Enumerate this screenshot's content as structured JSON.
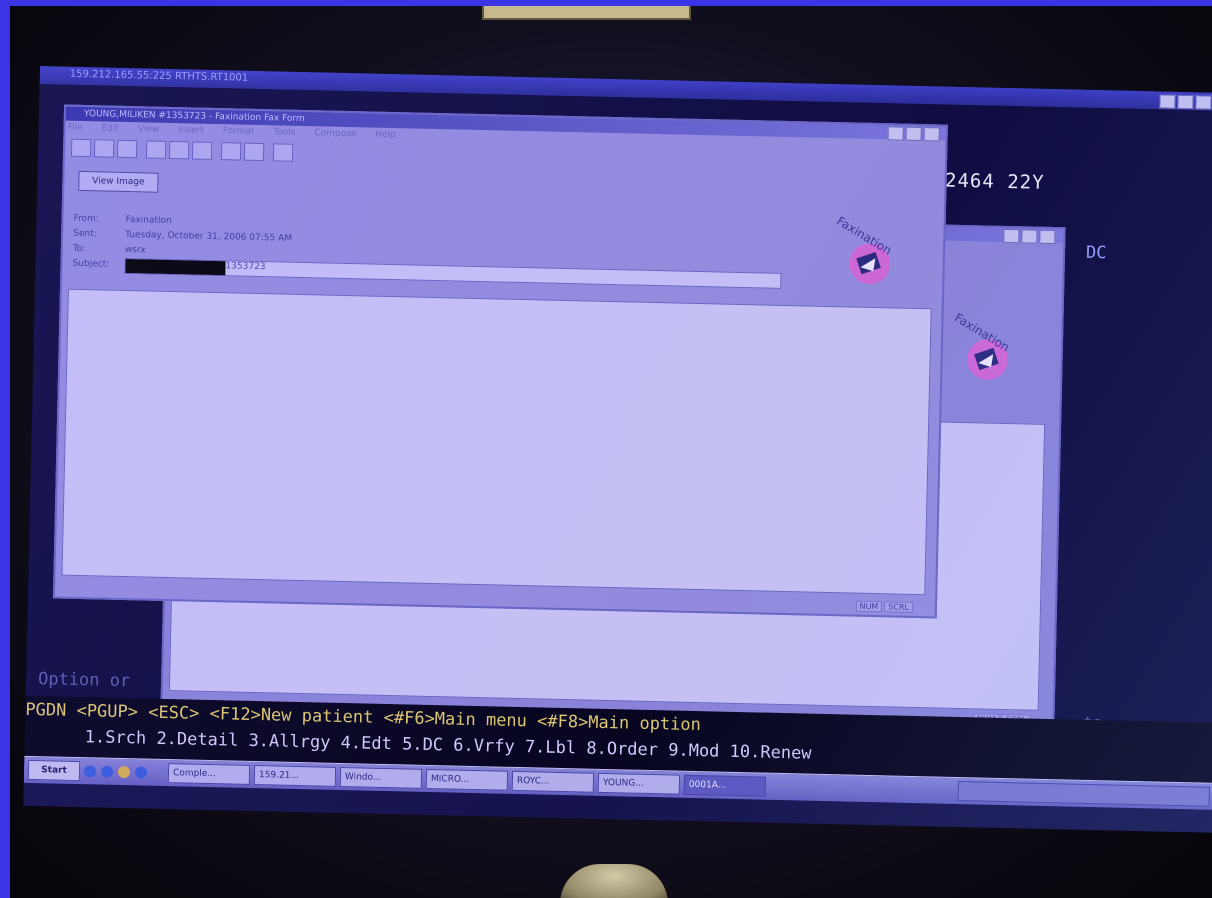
{
  "remote_session": {
    "title": "159.212.165.55:225 RTHTS.RT1001"
  },
  "terminal": {
    "patient_id": "42464 22Y",
    "column_label": "DC",
    "prompt": "Option or",
    "right_text": "ta",
    "function_keys": [
      "PGDN",
      "<PGUP>",
      "<ESC>",
      "<F12>New patient",
      "<#F6>Main menu",
      "<#F8>Main option"
    ],
    "options": [
      "1.Srch",
      "2.Detail",
      "3.Allrgy",
      "4.Edt",
      "5.DC",
      "6.Vrfy",
      "7.Lbl",
      "8.Order",
      "9.Mod",
      "10.Renew"
    ]
  },
  "fax_window": {
    "title": "YOUNG,MILIKEN #1353723 - Faxination Fax Form",
    "menu": [
      "File",
      "Edit",
      "View",
      "Insert",
      "Format",
      "Tools",
      "Compose",
      "Help"
    ],
    "view_image_label": "View Image",
    "fields": {
      "from_label": "From:",
      "from_value": "Faxination",
      "sent_label": "Sent:",
      "sent_value": "Tuesday, October 31, 2006 07:55 AM",
      "to_label": "To:",
      "to_value": "wsrx",
      "subject_label": "Subject:",
      "subject_suffix": "1353723"
    },
    "logo_text": "Faxination",
    "status": [
      "NUM",
      "SCRL"
    ]
  },
  "back_window": {
    "logo_text": "Faxination",
    "status": [
      "NUM",
      "SCRL"
    ]
  },
  "taskbar": {
    "start_label": "Start",
    "tasks": [
      "Comple...",
      "159.21...",
      "Windo...",
      "MICRO...",
      "ROYC...",
      "YOUNG...",
      "0001A..."
    ],
    "active_task": "0001A..."
  }
}
